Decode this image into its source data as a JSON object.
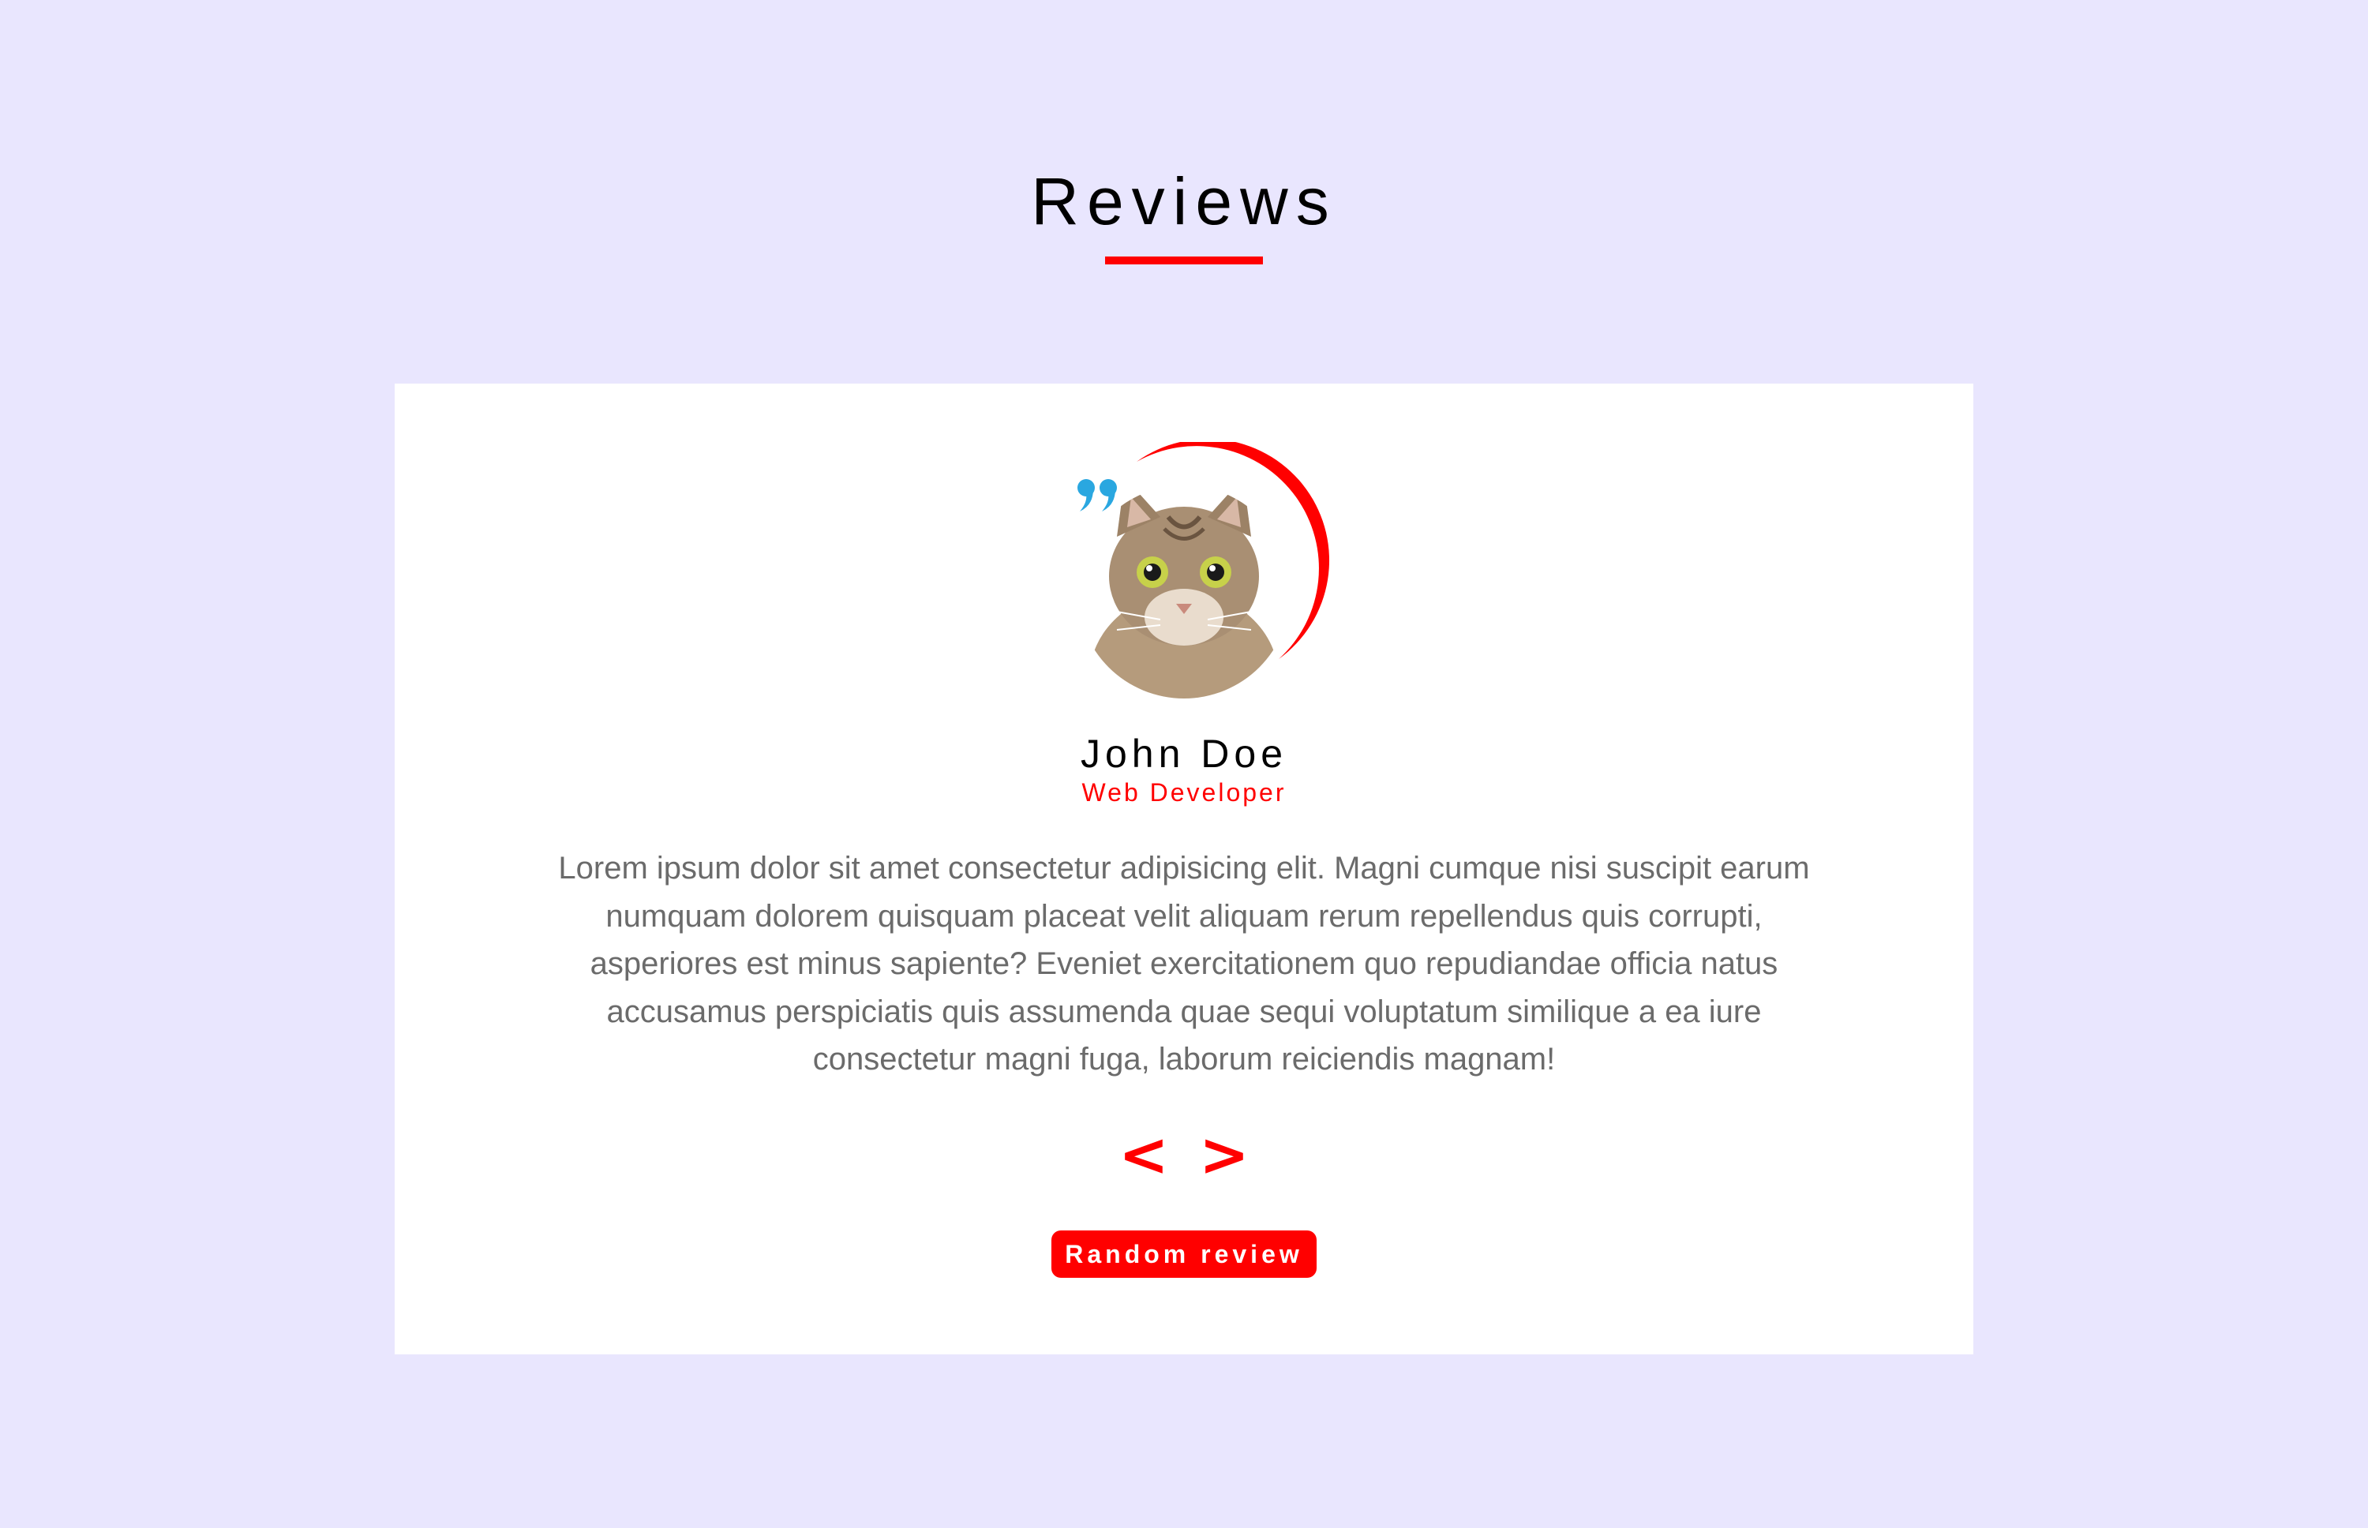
{
  "section": {
    "title": "Reviews"
  },
  "review": {
    "name": "John Doe",
    "job": "Web Developer",
    "text": "Lorem ipsum dolor sit amet consectetur adipisicing elit. Magni cumque nisi suscipit earum numquam dolorem quisquam placeat velit aliquam rerum repellendus quis corrupti, asperiores est minus sapiente? Eveniet exercitationem quo repudiandae officia natus accusamus perspiciatis quis assumenda quae sequi voluptatum similique a ea iure consectetur magni fuga, laborum reiciendis magnam!",
    "avatar_alt": "cat photo"
  },
  "controls": {
    "prev_label": "<",
    "next_label": ">",
    "random_label": "Random review"
  },
  "icons": {
    "quote": "quote-icon",
    "prev": "chevron-left-icon",
    "next": "chevron-right-icon"
  },
  "colors": {
    "background": "#e9e6fe",
    "card": "#ffffff",
    "accent": "#ff0000",
    "quote": "#2aa7e0",
    "text_muted": "#6b6b6b"
  }
}
